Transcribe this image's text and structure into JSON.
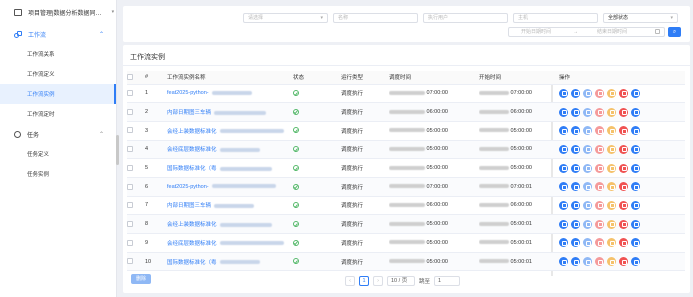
{
  "sidebar": {
    "project_label": "项目管理|数据分析数据同…",
    "groups": [
      {
        "label": "工作流",
        "items": [
          "工作流关系",
          "工作流定义",
          "工作流实例",
          "工作流定时"
        ]
      },
      {
        "label": "任务",
        "items": [
          "任务定义",
          "任务实例"
        ]
      }
    ]
  },
  "filter": {
    "select_placeholder": "请选择",
    "name_placeholder": "名称",
    "user_placeholder": "执行用户",
    "host_placeholder": "主机",
    "status_value": "全部状态",
    "start_placeholder": "开始日期时间",
    "end_placeholder": "结束日期时间",
    "range_sep": "→"
  },
  "card": {
    "title": "工作流实例",
    "columns": [
      "#",
      "工作流实例名称",
      "状态",
      "运行类型",
      "调度时间",
      "开始时间",
      "操作"
    ],
    "rows": [
      {
        "no": "1",
        "name": "feat2025-python-",
        "type": "调度执行",
        "sched": "07:00:00",
        "start": "07:00:00"
      },
      {
        "no": "2",
        "name": "内部日期图三车辆",
        "type": "调度执行",
        "sched": "06:00:00",
        "start": "06:00:00"
      },
      {
        "no": "3",
        "name": "会经上装数据标准化",
        "type": "调度执行",
        "sched": "05:00:00",
        "start": "05:00:00"
      },
      {
        "no": "4",
        "name": "会经底层数据标准化",
        "type": "调度执行",
        "sched": "05:00:00",
        "start": "05:00:00"
      },
      {
        "no": "5",
        "name": "国际数据标准化（粤",
        "type": "调度执行",
        "sched": "05:00:00",
        "start": "05:00:00"
      },
      {
        "no": "6",
        "name": "feat2025-python-",
        "type": "调度执行",
        "sched": "07:00:00",
        "start": "07:00:01"
      },
      {
        "no": "7",
        "name": "内部日期图三车辆",
        "type": "调度执行",
        "sched": "06:00:00",
        "start": "06:00:00"
      },
      {
        "no": "8",
        "name": "会经上装数据标准化",
        "type": "调度执行",
        "sched": "05:00:00",
        "start": "05:00:01"
      },
      {
        "no": "9",
        "name": "会经底层数据标准化",
        "type": "调度执行",
        "sched": "05:00:00",
        "start": "05:00:01"
      },
      {
        "no": "10",
        "name": "国际数据标准化（粤",
        "type": "调度执行",
        "sched": "05:00:00",
        "start": "05:00:01"
      }
    ]
  },
  "footer": {
    "delete_label": "删除",
    "page_current": "1",
    "page_size": "10 / 页",
    "jump_label": "跳至",
    "jump_value": "1",
    "prev": "‹",
    "next": "›"
  }
}
